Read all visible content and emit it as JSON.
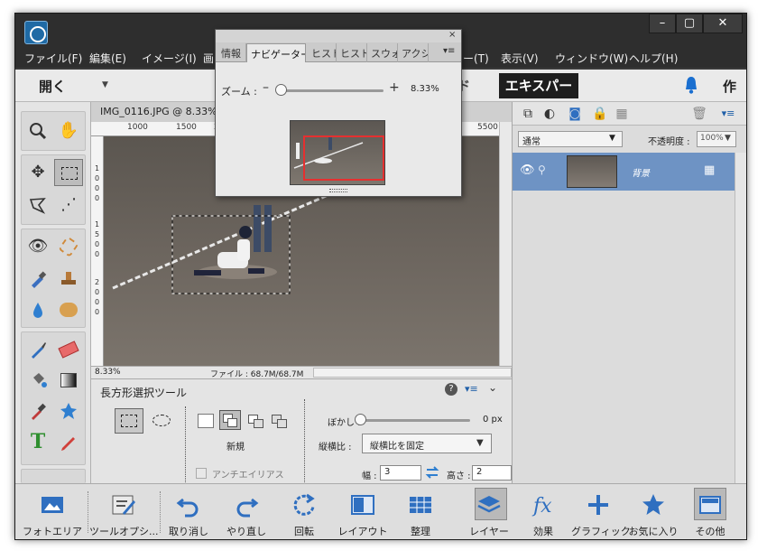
{
  "titlebar": {
    "min": "–",
    "max": "▢",
    "close": "✕"
  },
  "menu": [
    "ファイル(F)",
    "編集(E)",
    "イメージ(I)",
    "画",
    "ー(T)",
    "表示(V)",
    "ウィンドウ(W)",
    "ヘルプ(H)"
  ],
  "topbar": {
    "open": "開く",
    "guided_partial": "ド",
    "expert": "エキスパート",
    "create_partial": "作"
  },
  "document": {
    "title": "IMG_0116.JPG @ 8.33%(R",
    "ruler_top": [
      "1000",
      "1500",
      "200",
      "5500"
    ],
    "ruler_left": [
      "1",
      "0",
      "0",
      "0",
      "1",
      "5",
      "0",
      "0",
      "2",
      "0",
      "0",
      "0"
    ],
    "zoom": "8.33%",
    "file_info": "ファイル : 68.7M/68.7M"
  },
  "tool_options": {
    "title": "長方形選択ツール",
    "help": "?",
    "mode_label": "新規",
    "antialias": "アンチエイリアス",
    "feather_label": "ぼかし :",
    "feather_value": 0,
    "feather_text": "0 px",
    "aspect_label": "縦横比 :",
    "aspect_value": "縦横比を固定",
    "width_label": "幅 :",
    "width_value": "3",
    "height_label": "高さ :",
    "height_value": "2"
  },
  "layers": {
    "blend": "通常",
    "opacity_label": "不透明度 :",
    "opacity_value": "100%",
    "layer_name": "背景"
  },
  "navigator": {
    "tabs": [
      "情報",
      "ナビゲーター",
      "ヒスト",
      "ヒスト",
      "スウォ",
      "アクシ"
    ],
    "close": "×",
    "zoom_label": "ズーム :",
    "minus": "–",
    "plus": "+",
    "zoom_value": "8.33%"
  },
  "taskbar": [
    {
      "label": "フォトエリア",
      "icon": "photo-bin-icon"
    },
    {
      "label": "ツールオプシ...",
      "icon": "tool-options-icon"
    },
    {
      "label": "取り消し",
      "icon": "undo-icon"
    },
    {
      "label": "やり直し",
      "icon": "redo-icon"
    },
    {
      "label": "回転",
      "icon": "rotate-icon"
    },
    {
      "label": "レイアウト",
      "icon": "layout-icon"
    },
    {
      "label": "整理",
      "icon": "organizer-icon"
    },
    {
      "label": "レイヤー",
      "icon": "layers-icon"
    },
    {
      "label": "効果",
      "icon": "effects-icon"
    },
    {
      "label": "グラフィック",
      "icon": "graphics-icon"
    },
    {
      "label": "お気に入り",
      "icon": "favorites-icon"
    },
    {
      "label": "その他",
      "icon": "more-icon"
    }
  ],
  "colors": {
    "accent": "#1f6aa5",
    "layer_selected": "#6e93c4",
    "nav_box": "#e53030"
  }
}
